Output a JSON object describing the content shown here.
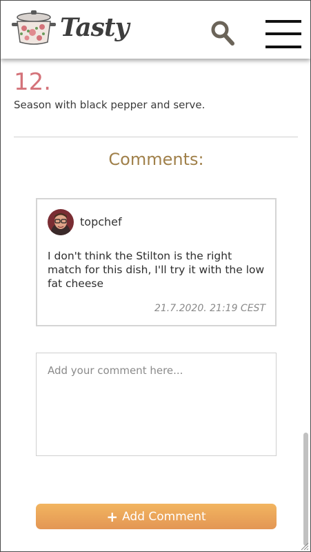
{
  "header": {
    "logo_text": "Tasty",
    "search_icon": "search-icon",
    "menu_icon": "hamburger-menu-icon"
  },
  "recipe": {
    "step_number": "12.",
    "step_text": "Season with black pepper and serve."
  },
  "comments": {
    "heading": "Comments:",
    "items": [
      {
        "username": "topchef",
        "text": "I don't think the Stilton is the right match for this dish, I'll try it with the low fat cheese",
        "date": "21.7.2020. 21:19 CEST"
      }
    ],
    "input_placeholder": "Add your comment here...",
    "add_button_label": "Add Comment"
  },
  "colors": {
    "step_number": "#d4737a",
    "heading": "#a0804a",
    "button_top": "#f2b560",
    "button_bottom": "#e39654"
  }
}
